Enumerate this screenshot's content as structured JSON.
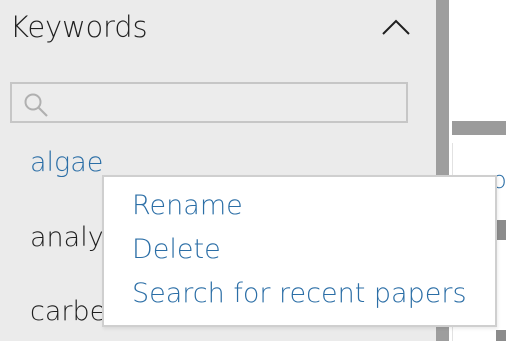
{
  "keywords_panel": {
    "title": "Keywords",
    "collapse_icon": "chevron-up-icon",
    "search": {
      "value": "",
      "placeholder": "",
      "icon": "search-icon"
    },
    "items": [
      {
        "label": "algae",
        "state": "selected"
      },
      {
        "label": "analy",
        "state": "normal"
      },
      {
        "label": "carbe",
        "state": "normal"
      }
    ]
  },
  "right_panel": {
    "fragment_text": "o"
  },
  "context_menu": {
    "items": [
      {
        "label": "Rename"
      },
      {
        "label": "Delete"
      },
      {
        "label": "Search for recent papers"
      }
    ]
  },
  "colors": {
    "panel_bg": "#ebebeb",
    "accent": "#2b6ea6",
    "text": "#1f1f1f",
    "splitter": "#9e9e9e",
    "menu_border": "#cfcfcf"
  }
}
